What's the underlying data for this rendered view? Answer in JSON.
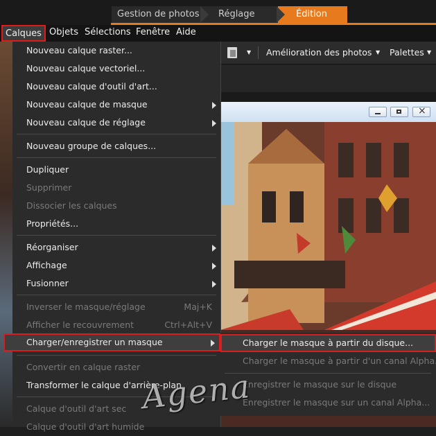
{
  "workspace_tabs": {
    "gestion": "Gestion de photos",
    "reglage": "Réglage",
    "edition": "Édition"
  },
  "menubar": {
    "calques": "Calques",
    "objets": "Objets",
    "selections": "Sélections",
    "fenetre": "Fenêtre",
    "aide": "Aide"
  },
  "toolbar": {
    "amelioration": "Amélioration des photos",
    "palettes": "Palettes",
    "caret": "▼"
  },
  "menu": {
    "items": [
      {
        "label": "Nouveau calque raster...",
        "disabled": false
      },
      {
        "label": "Nouveau calque vectoriel...",
        "disabled": false
      },
      {
        "label": "Nouveau calque d'outil d'art...",
        "disabled": false
      },
      {
        "label": "Nouveau calque de masque",
        "disabled": false,
        "submenu": true
      },
      {
        "label": "Nouveau calque de réglage",
        "disabled": false,
        "submenu": true
      },
      {
        "label": "Nouveau groupe de calques...",
        "disabled": false
      },
      {
        "label": "Dupliquer",
        "disabled": false
      },
      {
        "label": "Supprimer",
        "disabled": true
      },
      {
        "label": "Dissocier les calques",
        "disabled": true
      },
      {
        "label": "Propriétés...",
        "disabled": false
      },
      {
        "label": "Réorganiser",
        "disabled": false,
        "submenu": true
      },
      {
        "label": "Affichage",
        "disabled": false,
        "submenu": true
      },
      {
        "label": "Fusionner",
        "disabled": false,
        "submenu": true
      },
      {
        "label": "Inverser le masque/réglage",
        "disabled": true,
        "shortcut": "Maj+K"
      },
      {
        "label": "Afficher le recouvrement",
        "disabled": true,
        "shortcut": "Ctrl+Alt+V"
      },
      {
        "label": "Charger/enregistrer un masque",
        "disabled": false,
        "submenu": true,
        "highlighted": true
      },
      {
        "label": "Convertir en calque raster",
        "disabled": true
      },
      {
        "label": "Transformer le calque d'arrière-plan",
        "disabled": false
      },
      {
        "label": "Calque d'outil d'art sec",
        "disabled": true
      },
      {
        "label": "Calque d'outil d'art humide",
        "disabled": true
      }
    ]
  },
  "submenu": {
    "items": [
      {
        "label": "Charger le masque à partir du disque...",
        "disabled": false,
        "highlighted": true
      },
      {
        "label": "Charger le masque à partir d'un canal Alpha...",
        "disabled": true
      },
      {
        "label": "Enregistrer le masque sur le disque",
        "disabled": true
      },
      {
        "label": "Enregistrer le masque sur un canal Alpha...",
        "disabled": true
      }
    ]
  },
  "watermark": "Agena",
  "colors": {
    "accent": "#e87a1e",
    "highlight_border": "#d81e1e"
  },
  "icons": {
    "paste": "paste-icon",
    "minimize": "minimize-icon",
    "restore": "restore-icon",
    "close": "close-icon"
  }
}
